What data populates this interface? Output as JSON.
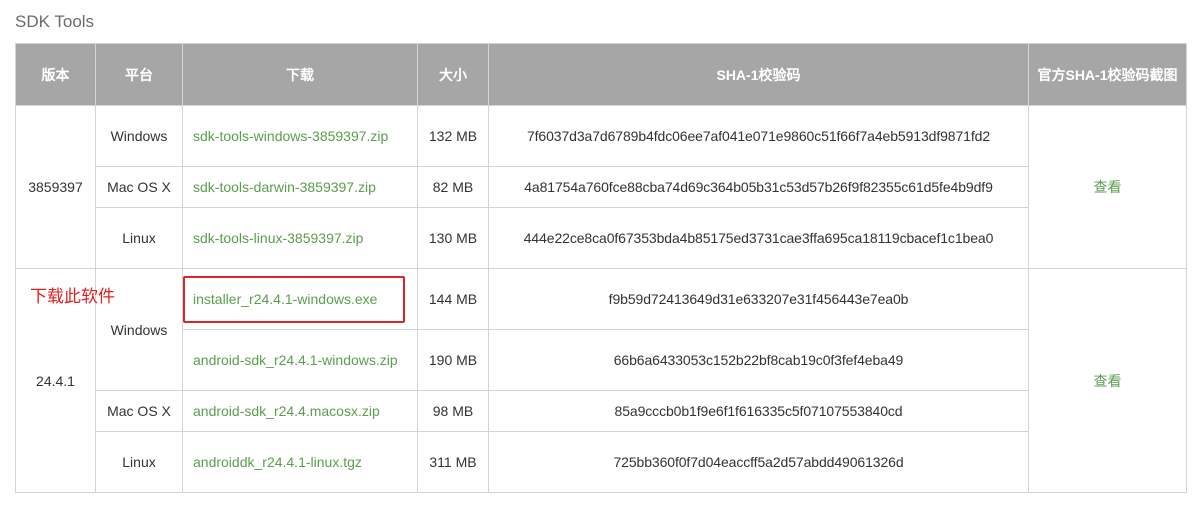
{
  "section_title": "SDK Tools",
  "headers": {
    "version": "版本",
    "platform": "平台",
    "download": "下载",
    "size": "大小",
    "sha1": "SHA-1校验码",
    "sha1_screenshot": "官方SHA-1校验码截图"
  },
  "groups": [
    {
      "version": "3859397",
      "view_label": "查看",
      "rows": [
        {
          "platform": "Windows",
          "file": "sdk-tools-windows-3859397.zip",
          "size": "132 MB",
          "sha1": "7f6037d3a7d6789b4fdc06ee7af041e071e9860c51f66f7a4eb5913df9871fd2"
        },
        {
          "platform": "Mac OS X",
          "file": "sdk-tools-darwin-3859397.zip",
          "size": "82 MB",
          "sha1": "4a81754a760fce88cba74d69c364b05b31c53d57b26f9f82355c61d5fe4b9df9"
        },
        {
          "platform": "Linux",
          "file": "sdk-tools-linux-3859397.zip",
          "size": "130 MB",
          "sha1": "444e22ce8ca0f67353bda4b85175ed3731cae3ffa695ca18119cbacef1c1bea0"
        }
      ]
    },
    {
      "version": "24.4.1",
      "view_label": "查看",
      "windows_platform": "Windows",
      "rows": [
        {
          "file": "installer_r24.4.1-windows.exe",
          "size": "144 MB",
          "sha1": "f9b59d72413649d31e633207e31f456443e7ea0b"
        },
        {
          "file": "android-sdk_r24.4.1-windows.zip",
          "size": "190 MB",
          "sha1": "66b6a6433053c152b22bf8cab19c0f3fef4eba49"
        },
        {
          "platform": "Mac OS X",
          "file": "android-sdk_r24.4.macosx.zip",
          "size": "98 MB",
          "sha1": "85a9cccb0b1f9e6f1f616335c5f07107553840cd"
        },
        {
          "platform": "Linux",
          "file": "androiddk_r24.4.1-linux.tgz",
          "size": "311 MB",
          "sha1": "725bb360f0f7d04eaccff5a2d57abdd49061326d"
        }
      ]
    }
  ],
  "annotation": {
    "text": "下载此软件",
    "color": "#e02020"
  },
  "colors": {
    "header_bg": "#a6a6a6",
    "link": "#5a9e4e",
    "border": "#d4d4d4",
    "highlight": "#d9262a"
  }
}
